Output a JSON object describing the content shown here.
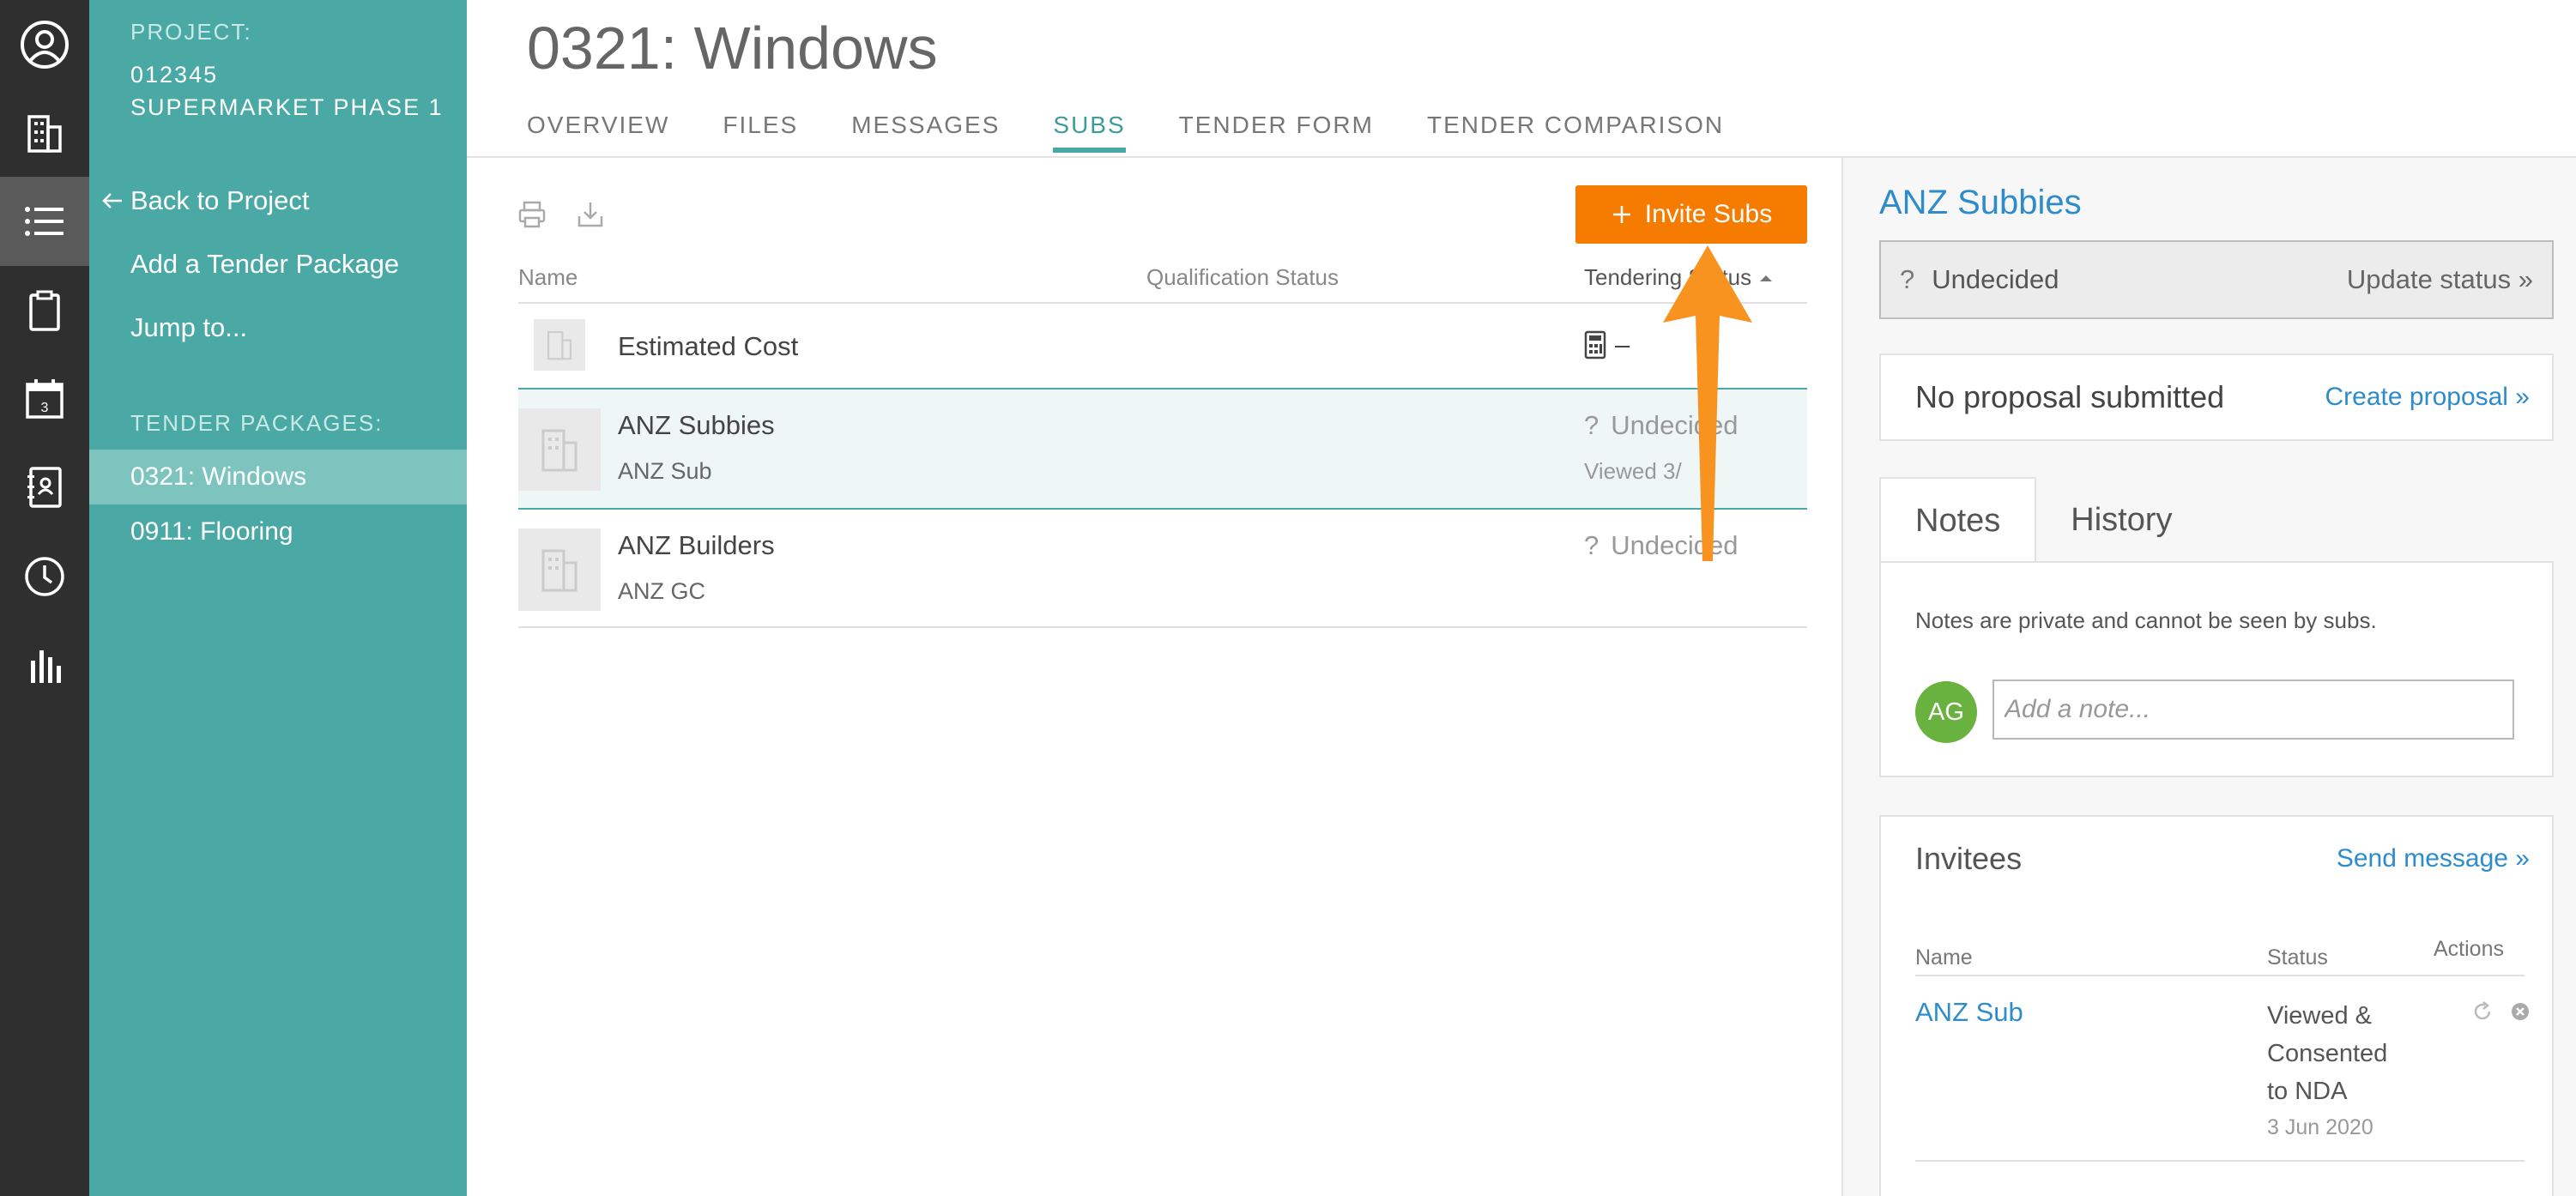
{
  "sidebar": {
    "project_label": "PROJECT:",
    "project_number": "012345",
    "project_name": "SUPERMARKET PHASE 1",
    "back_link": "Back to Project",
    "add_package": "Add a Tender Package",
    "jump_to": "Jump to...",
    "packages_label": "TENDER PACKAGES:",
    "packages": [
      {
        "label": "0321: Windows",
        "active": true
      },
      {
        "label": "0911: Flooring",
        "active": false
      }
    ]
  },
  "rail": {
    "items": [
      "user-icon",
      "building-icon",
      "list-icon",
      "clipboard-icon",
      "calendar-icon",
      "contacts-book-icon",
      "clock-icon",
      "bar-chart-icon"
    ],
    "calendar_day": "3"
  },
  "header": {
    "title": "0321: Windows",
    "tabs": [
      {
        "label": "OVERVIEW",
        "active": false
      },
      {
        "label": "FILES",
        "active": false
      },
      {
        "label": "MESSAGES",
        "active": false
      },
      {
        "label": "SUBS",
        "active": true
      },
      {
        "label": "TENDER FORM",
        "active": false
      },
      {
        "label": "TENDER COMPARISON",
        "active": false
      }
    ]
  },
  "subs": {
    "invite_button": "Invite Subs",
    "columns": {
      "name": "Name",
      "qualification": "Qualification Status",
      "tendering": "Tendering Status"
    },
    "estimated_cost": {
      "label": "Estimated Cost",
      "value": "–"
    },
    "rows": [
      {
        "name": "ANZ Subbies",
        "contact": "ANZ Sub",
        "status": "Undecided",
        "status_sub": "Viewed 3/",
        "selected": true
      },
      {
        "name": "ANZ Builders",
        "contact": "ANZ GC",
        "status": "Undecided",
        "status_sub": "",
        "selected": false
      }
    ]
  },
  "detail": {
    "title": "ANZ Subbies",
    "status_q": "?",
    "status": "Undecided",
    "update_status": "Update status »",
    "proposal_text": "No proposal submitted",
    "create_proposal": "Create proposal »",
    "tabs": [
      {
        "label": "Notes",
        "active": true
      },
      {
        "label": "History",
        "active": false
      }
    ],
    "notes_info": "Notes are private and cannot be seen by subs.",
    "avatar_initials": "AG",
    "note_placeholder": "Add a note...",
    "invitees": {
      "title": "Invitees",
      "send_message": "Send message »",
      "columns": {
        "name": "Name",
        "status": "Status",
        "actions": "Actions"
      },
      "rows": [
        {
          "name": "ANZ Sub",
          "status_lines": [
            "Viewed &",
            "Consented",
            "to NDA"
          ],
          "date": "3 Jun 2020"
        }
      ]
    }
  },
  "colors": {
    "teal": "#4aa9a4",
    "orange": "#f57c00",
    "link_blue": "#2e8ccb",
    "rail": "#2f2f2f"
  }
}
